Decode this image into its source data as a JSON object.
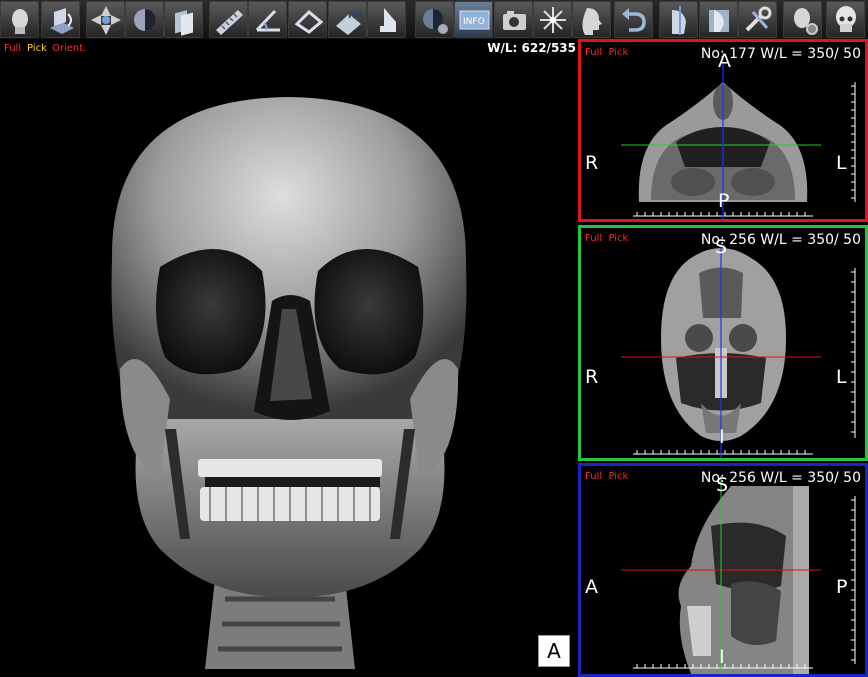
{
  "toolbar": {
    "buttons": [
      {
        "icon": "head-volume-icon"
      },
      {
        "icon": "rotate-cube-icon"
      },
      {
        "icon": "navigate-arrows-icon"
      },
      {
        "icon": "sphere-shading-icon"
      },
      {
        "icon": "slab-stack-icon"
      },
      {
        "icon": "ruler-icon"
      },
      {
        "icon": "angle-tool-icon"
      },
      {
        "icon": "area-tool-icon"
      },
      {
        "icon": "hu-measure-icon"
      },
      {
        "icon": "pointer-icon"
      },
      {
        "icon": "color-palette-icon"
      },
      {
        "icon": "info-icon",
        "label": "INFO"
      },
      {
        "icon": "camera-icon"
      },
      {
        "icon": "crosshair-icon"
      },
      {
        "icon": "head-profile-icon"
      },
      {
        "icon": "undo-icon"
      },
      {
        "icon": "cut-plane-icon"
      },
      {
        "icon": "clip-box-icon"
      },
      {
        "icon": "tools-settings-icon"
      },
      {
        "icon": "head-settings-icon"
      },
      {
        "icon": "skull-icon"
      }
    ]
  },
  "main_view": {
    "overlay": {
      "full": "Full",
      "pick": "Pick",
      "orient": "Orient."
    },
    "wl": "W/L: 622/535",
    "orientation_label": "A"
  },
  "panels": {
    "axial": {
      "full": "Full",
      "pick": "Pick",
      "info": "No: 177  W/L = 350/ 50",
      "top": "A",
      "bottom": "P",
      "left": "R",
      "right": "L"
    },
    "coronal": {
      "full": "Full",
      "pick": "Pick",
      "info": "No: 256  W/L = 350/ 50",
      "top": "S",
      "bottom": "I",
      "left": "R",
      "right": "L"
    },
    "sagittal": {
      "full": "Full",
      "pick": "Pick",
      "info": "No: 256  W/L = 350/ 50",
      "top": "S",
      "bottom": "I",
      "left": "A",
      "right": "P"
    }
  },
  "colors": {
    "overlay_red": "#ff2a2a",
    "overlay_yellow": "#ffd400",
    "axial_border": "#e01616",
    "coronal_border": "#27c63a",
    "sagittal_border": "#1a26c0",
    "crosshair_green": "#20d020",
    "crosshair_red": "#e01010",
    "crosshair_blue": "#2030ff"
  }
}
